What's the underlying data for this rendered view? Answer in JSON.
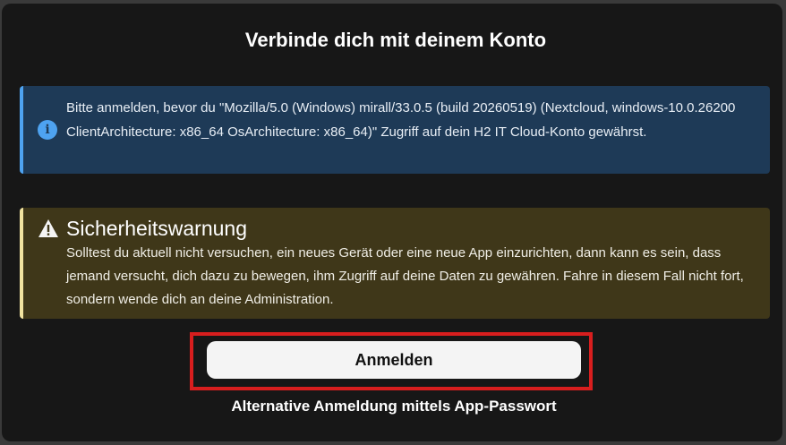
{
  "dialog": {
    "title": "Verbinde dich mit deinem Konto"
  },
  "info": {
    "icon": "info-icon",
    "glyph": "i",
    "accent_color": "#4ea3f1",
    "background": "#1e3a57",
    "text": "Bitte anmelden, bevor du \"Mozilla/5.0 (Windows) mirall/33.0.5 (build 20260519) (Nextcloud, windows-10.0.26200 ClientArchitecture: x86_64 OsArchitecture: x86_64)\" Zugriff auf dein H2 IT Cloud-Konto gewährst."
  },
  "warning": {
    "icon": "warning-triangle-icon",
    "accent_color": "#f1e3a0",
    "background": "#3f3719",
    "title": "Sicherheitswarnung",
    "text": "Solltest du aktuell nicht versuchen, ein neues Gerät oder eine neue App einzurichten, dann kann es sein, dass jemand versucht, dich dazu zu bewegen, ihm Zugriff auf deine Daten zu gewähren. Fahre in diesem Fall nicht fort, sondern wende dich an deine Administration."
  },
  "actions": {
    "login_label": "Anmelden",
    "alt_login_label": "Alternative Anmeldung mittels App-Passwort",
    "highlight_color": "#d81e1e"
  }
}
